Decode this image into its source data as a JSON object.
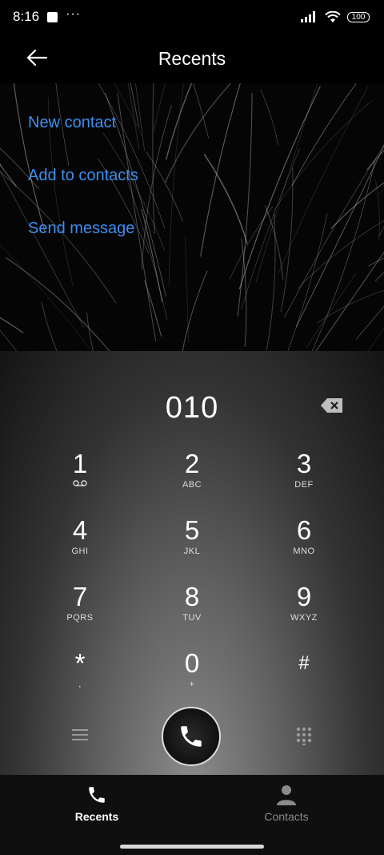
{
  "status_bar": {
    "time": "8:16",
    "battery": "100"
  },
  "header": {
    "title": "Recents"
  },
  "actions": {
    "new_contact": "New contact",
    "add_to_contacts": "Add to contacts",
    "send_message": "Send message"
  },
  "dialer": {
    "number": "010",
    "keys": [
      {
        "digit": "1",
        "letters": ""
      },
      {
        "digit": "2",
        "letters": "ABC"
      },
      {
        "digit": "3",
        "letters": "DEF"
      },
      {
        "digit": "4",
        "letters": "GHI"
      },
      {
        "digit": "5",
        "letters": "JKL"
      },
      {
        "digit": "6",
        "letters": "MNO"
      },
      {
        "digit": "7",
        "letters": "PQRS"
      },
      {
        "digit": "8",
        "letters": "TUV"
      },
      {
        "digit": "9",
        "letters": "WXYZ"
      },
      {
        "digit": "*",
        "letters": ","
      },
      {
        "digit": "0",
        "letters": "+"
      },
      {
        "digit": "#",
        "letters": ""
      }
    ]
  },
  "bottom_nav": {
    "recents": "Recents",
    "contacts": "Contacts"
  },
  "icons": {
    "back": "arrow-left-icon",
    "backspace": "backspace-icon",
    "voicemail": "voicemail-icon",
    "menu": "menu-icon",
    "call": "phone-icon",
    "dialpad": "dialpad-icon",
    "recents": "phone-icon",
    "contacts": "person-icon"
  },
  "colors": {
    "accent": "#3d8ef2",
    "background": "#000000",
    "nav_active": "#ffffff",
    "nav_inactive": "#8a8a8a"
  }
}
